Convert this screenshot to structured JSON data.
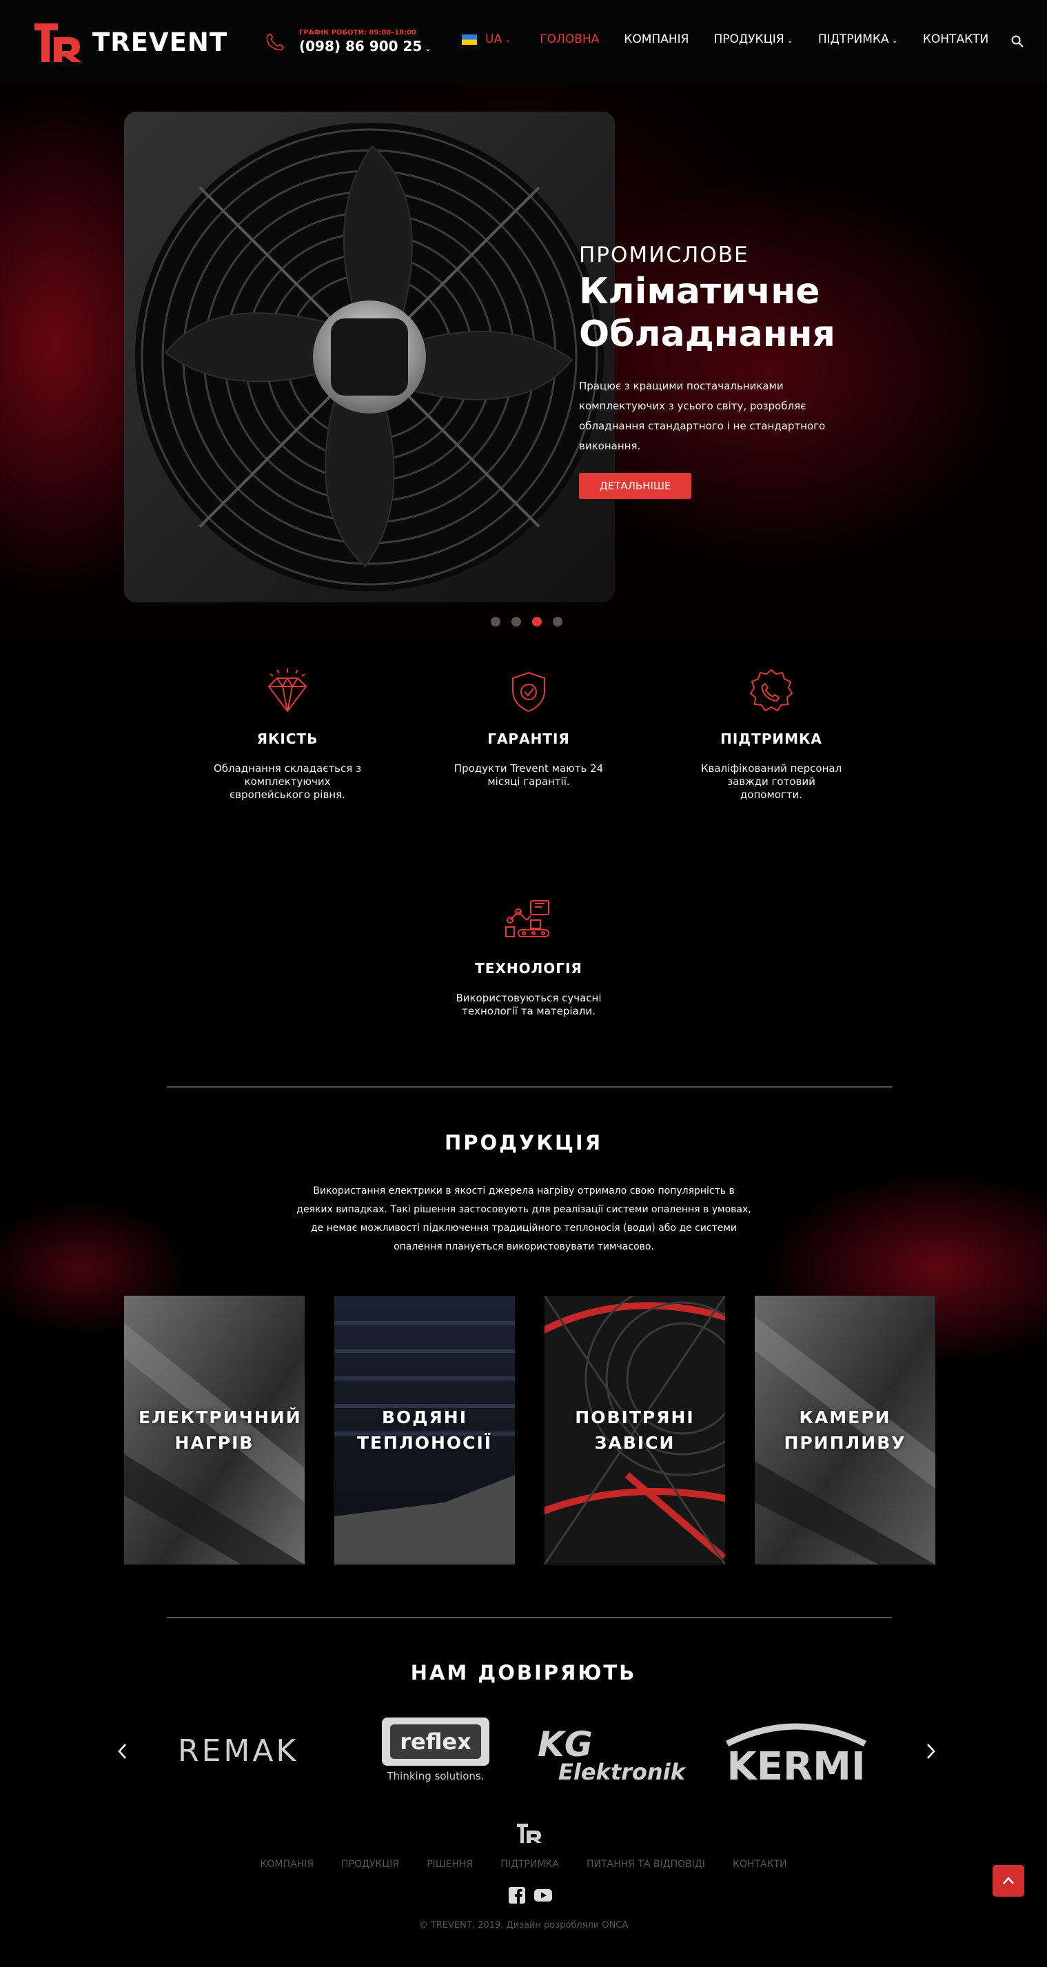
{
  "header": {
    "logo_text": "TREVENT",
    "schedule": "ГРАФІК РОБОТИ: 09:00–18:00",
    "phone": "(098) 86 900 25",
    "language": "UA",
    "nav": [
      {
        "label": "ГОЛОВНА",
        "active": true
      },
      {
        "label": "КОМПАНІЯ"
      },
      {
        "label": "ПРОДУКЦІЯ"
      },
      {
        "label": "ПІДТРИМКА"
      },
      {
        "label": "КОНТАКТИ"
      }
    ]
  },
  "hero": {
    "kicker": "ПРОМИСЛОВЕ",
    "title_line1": "Кліматичне",
    "title_line2": "Обладнання",
    "description": "Працює з кращими постачальниками комплектуючих з усього світу, розробляє обладнання стандартного і не стандартного виконання.",
    "button": "ДЕТАЛЬНІШЕ",
    "slides_count": 4,
    "active_slide": 3
  },
  "features": [
    {
      "icon": "diamond-icon",
      "title": "ЯКІСТЬ",
      "text": "Обладнання складається з комплектуючих європейського рівня."
    },
    {
      "icon": "shield-check-icon",
      "title": "ГАРАНТІЯ",
      "text": "Продукти Trevent мають 24 місяці гарантії."
    },
    {
      "icon": "support-phone-icon",
      "title": "ПІДТРИМКА",
      "text": "Кваліфікований персонал завжди готовий допомогти."
    },
    {
      "icon": "robot-arm-icon",
      "title": "ТЕХНОЛОГІЯ",
      "text": "Використовуються сучасні технології та матеріали."
    }
  ],
  "products": {
    "title": "ПРОДУКЦІЯ",
    "description": "Використання електрики в якості джерела нагріву отримало свою популярність в деяких випадках. Такі рішення застосовують для реалізації системи опалення в умовах, де немає можливості підключення традиційного теплоносія (води) або де системи опалення планується використовувати тимчасово.",
    "items": [
      {
        "label": "ЕЛЕКТРИЧНИЙ НАГРІВ"
      },
      {
        "label": "ВОДЯНІ ТЕПЛОНОСІЇ"
      },
      {
        "label": "ПОВІТРЯНІ ЗАВІСИ"
      },
      {
        "label": "КАМЕРИ ПРИПЛИВУ"
      }
    ]
  },
  "partners": {
    "title": "НАМ ДОВІРЯЮТЬ",
    "logos": [
      "REMAK",
      "reflex",
      "Thinking solutions.",
      "KG",
      "Elektronik",
      "KERMI"
    ]
  },
  "footer": {
    "nav": [
      "КОМПАНІЯ",
      "ПРОДУКЦІЯ",
      "РІШЕННЯ",
      "ПІДТРИМКА",
      "ПИТАННЯ ТА ВІДПОВІДІ",
      "КОНТАКТИ"
    ],
    "copyright": "© TREVENT, 2019. Дизайн розробляли ONCA"
  },
  "colors": {
    "accent": "#e53935",
    "background": "#000000"
  }
}
